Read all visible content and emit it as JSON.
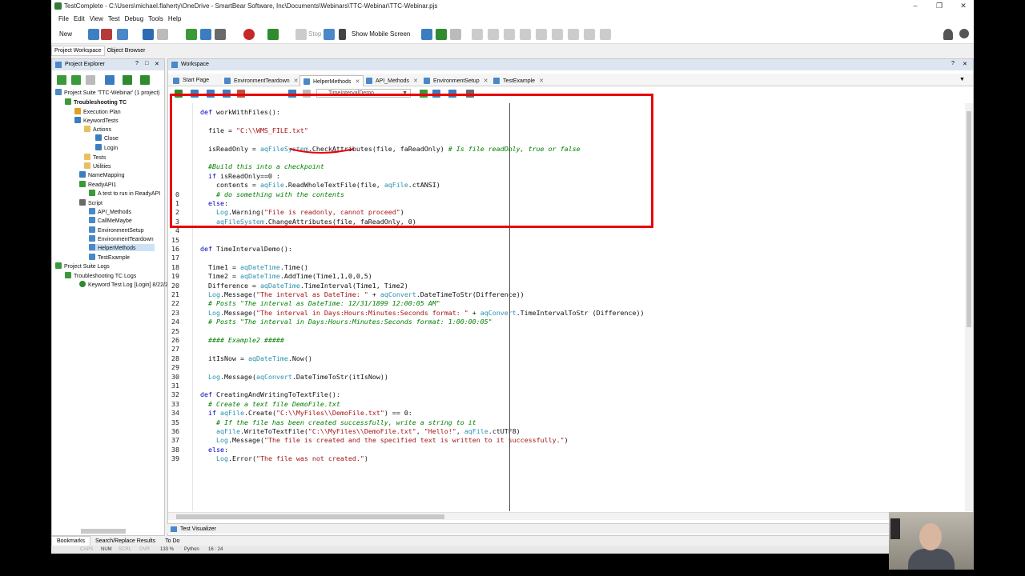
{
  "window": {
    "title": "TestComplete - C:\\Users\\michael.flaherty\\OneDrive - SmartBear Software, Inc\\Documents\\Webinars\\TTC-Webinar\\TTC-Webinar.pjs"
  },
  "menu": [
    "File",
    "Edit",
    "View",
    "Test",
    "Debug",
    "Tools",
    "Help"
  ],
  "toolbar": {
    "new_label": "New",
    "stop_label": "Stop",
    "show_mobile_label": "Show Mobile Screen"
  },
  "left_tabs": [
    "Project Workspace",
    "Object Browser"
  ],
  "project_explorer": {
    "title": "Project Explorer",
    "items": [
      {
        "label": "Project Suite 'TTC-Webinar' (1 project)"
      },
      {
        "label": "Troubleshooting TC"
      },
      {
        "label": "Execution Plan"
      },
      {
        "label": "KeywordTests"
      },
      {
        "label": "Actions"
      },
      {
        "label": "Close"
      },
      {
        "label": "Login"
      },
      {
        "label": "Tests"
      },
      {
        "label": "Utilities"
      },
      {
        "label": "NameMapping"
      },
      {
        "label": "ReadyAPI1"
      },
      {
        "label": "A test to run in ReadyAPI"
      },
      {
        "label": "Script"
      },
      {
        "label": "API_Methods"
      },
      {
        "label": "CallMeMaybe"
      },
      {
        "label": "EnvironmentSetup"
      },
      {
        "label": "EnvironmentTeardown"
      },
      {
        "label": "HelperMethods"
      },
      {
        "label": "TestExample"
      },
      {
        "label": "Project Suite Logs"
      },
      {
        "label": "Troubleshooting TC Logs"
      },
      {
        "label": "Keyword Test Log [Login] 8/22/2"
      }
    ]
  },
  "workspace": {
    "title": "Workspace",
    "tabs": [
      "Start Page",
      "EnvironmentTeardown",
      "HelperMethods",
      "API_Methods",
      "EnvironmentSetup",
      "TestExample"
    ],
    "active_tab": "HelperMethods",
    "dropdown_value": "TimeIntervalDemo"
  },
  "code_lines": [
    {
      "n": "",
      "t": "def workWithFiles():"
    },
    {
      "n": "",
      "t": ""
    },
    {
      "n": "",
      "t": "  file = \"C:\\\\WMS_FILE.txt\""
    },
    {
      "n": "",
      "t": ""
    },
    {
      "n": "",
      "t": "  isReadOnly = aqFileSystem.CheckAttributes(file, faReadOnly) # Is file readOnly, true or false"
    },
    {
      "n": "",
      "t": ""
    },
    {
      "n": "",
      "t": "  #Build this into a checkpoint"
    },
    {
      "n": "",
      "t": "  if isReadOnly==0 :"
    },
    {
      "n": "",
      "t": "    contents = aqFile.ReadWholeTextFile(file, aqFile.ctANSI)"
    },
    {
      "n": "0",
      "t": "    # do something with the contents"
    },
    {
      "n": "1",
      "t": "  else:"
    },
    {
      "n": "2",
      "t": "    Log.Warning(\"File is readonly, cannot proceed\")"
    },
    {
      "n": "3",
      "t": "    aqFileSystem.ChangeAttributes(file, faReadOnly, 0)"
    },
    {
      "n": "4",
      "t": ""
    },
    {
      "n": "15",
      "t": ""
    },
    {
      "n": "16",
      "t": "def TimeIntervalDemo():"
    },
    {
      "n": "17",
      "t": ""
    },
    {
      "n": "18",
      "t": "  Time1 = aqDateTime.Time()"
    },
    {
      "n": "19",
      "t": "  Time2 = aqDateTime.AddTime(Time1,1,0,0,5)"
    },
    {
      "n": "20",
      "t": "  Difference = aqDateTime.TimeInterval(Time1, Time2)"
    },
    {
      "n": "21",
      "t": "  Log.Message(\"The interval as DateTime: \" + aqConvert.DateTimeToStr(Difference))"
    },
    {
      "n": "22",
      "t": "  # Posts \"The interval as DateTime: 12/31/1899 12:00:05 AM\""
    },
    {
      "n": "23",
      "t": "  Log.Message(\"The interval in Days:Hours:Minutes:Seconds format: \" + aqConvert.TimeIntervalToStr (Difference))"
    },
    {
      "n": "24",
      "t": "  # Posts \"The interval in Days:Hours:Minutes:Seconds format: 1:00:00:05\""
    },
    {
      "n": "25",
      "t": ""
    },
    {
      "n": "26",
      "t": "  #### Example2 #####"
    },
    {
      "n": "27",
      "t": ""
    },
    {
      "n": "28",
      "t": "  itIsNow = aqDateTime.Now()"
    },
    {
      "n": "29",
      "t": ""
    },
    {
      "n": "30",
      "t": "  Log.Message(aqConvert.DateTimeToStr(itIsNow))"
    },
    {
      "n": "31",
      "t": ""
    },
    {
      "n": "32",
      "t": "def CreatingAndWritingToTextFile():"
    },
    {
      "n": "33",
      "t": "  # Create a text file DemoFile.txt"
    },
    {
      "n": "34",
      "t": "  if aqFile.Create(\"C:\\\\MyFiles\\\\DemoFile.txt\") == 0:"
    },
    {
      "n": "35",
      "t": "    # If the file has been created successfully, write a string to it"
    },
    {
      "n": "36",
      "t": "    aqFile.WriteToTextFile(\"C:\\\\MyFiles\\\\DemoFile.txt\", \"Hello!\", aqFile.ctUTF8)"
    },
    {
      "n": "37",
      "t": "    Log.Message(\"The file is created and the specified text is written to it successfully.\")"
    },
    {
      "n": "38",
      "t": "  else:"
    },
    {
      "n": "39",
      "t": "    Log.Error(\"The file was not created.\")"
    }
  ],
  "test_visualizer": "Test Visualizer",
  "bottom_tabs": [
    "Bookmarks",
    "Search/Replace Results",
    "To Do"
  ],
  "status": {
    "caps": "CAPS",
    "num": "NUM",
    "scrl": "SCRL",
    "ovr": "OVR",
    "zoom": "133 %",
    "lang": "Python",
    "pos": "16 : 24"
  },
  "colors": {
    "highlight_box": "#e8000b",
    "keyword": "#0000c0",
    "object": "#2b91af",
    "string": "#a31515",
    "comment": "#008000"
  }
}
